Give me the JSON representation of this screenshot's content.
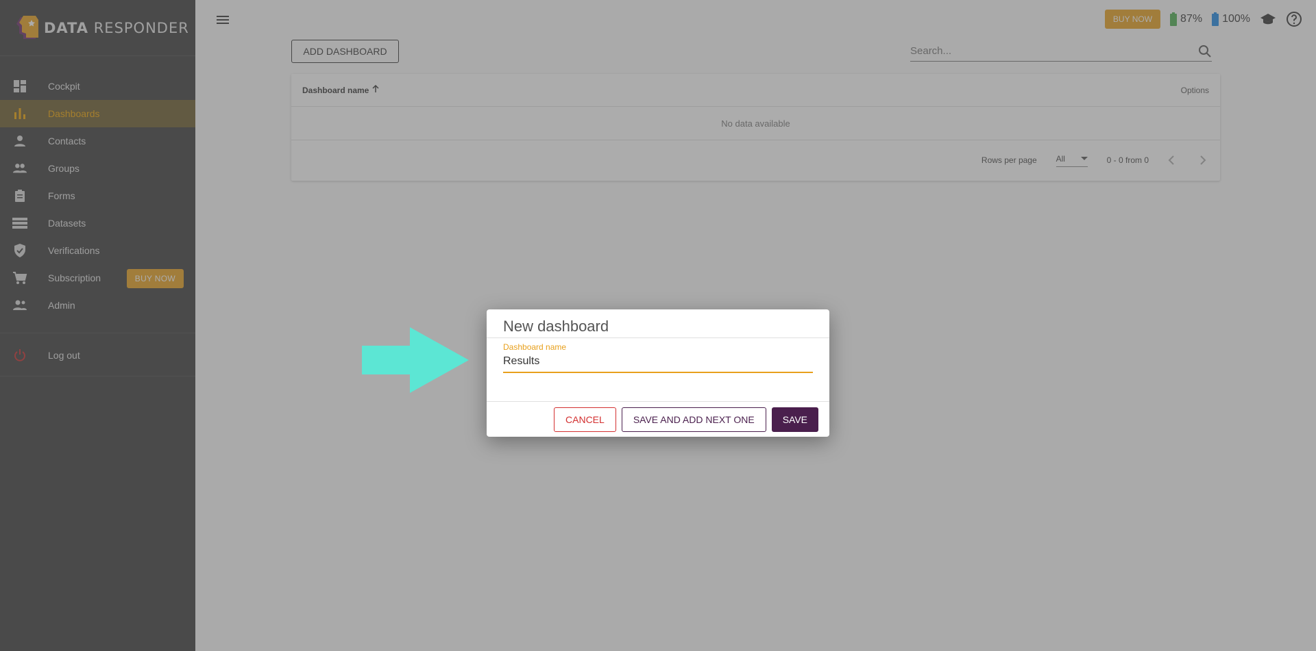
{
  "brand": {
    "name_bold": "DATA",
    "name_rest": "RESPONDER"
  },
  "sidebar": {
    "items": [
      {
        "label": "Cockpit",
        "icon": "dashboard-grid-icon"
      },
      {
        "label": "Dashboards",
        "icon": "bar-chart-icon",
        "active": true
      },
      {
        "label": "Contacts",
        "icon": "person-icon"
      },
      {
        "label": "Groups",
        "icon": "group-icon"
      },
      {
        "label": "Forms",
        "icon": "clipboard-icon"
      },
      {
        "label": "Datasets",
        "icon": "list-icon"
      },
      {
        "label": "Verifications",
        "icon": "shield-check-icon"
      },
      {
        "label": "Subscription",
        "icon": "cart-icon",
        "badge": "BUY NOW"
      },
      {
        "label": "Admin",
        "icon": "admin-people-icon"
      }
    ],
    "logout": {
      "label": "Log out",
      "icon": "power-icon"
    }
  },
  "topbar": {
    "buy_now": "BUY NOW",
    "battery_green": "87%",
    "battery_blue": "100%",
    "colors": {
      "accent": "#e8a01c",
      "battery_green": "#4caf50",
      "battery_blue": "#1e88e5"
    }
  },
  "main": {
    "add_button": "ADD DASHBOARD",
    "search_placeholder": "Search...",
    "table": {
      "col_name": "Dashboard name",
      "col_options": "Options",
      "empty": "No data available",
      "rows_per_page_label": "Rows per page",
      "rows_per_page_value": "All",
      "range": "0 - 0 from 0"
    }
  },
  "dialog": {
    "title": "New dashboard",
    "field_label": "Dashboard name",
    "field_value": "Results",
    "cancel": "CANCEL",
    "save_next": "SAVE AND ADD NEXT ONE",
    "save": "SAVE",
    "colors": {
      "primary": "#4a1f4d",
      "danger": "#d32f2f"
    }
  },
  "annotation": {
    "arrow_color": "#5ce6d4"
  }
}
